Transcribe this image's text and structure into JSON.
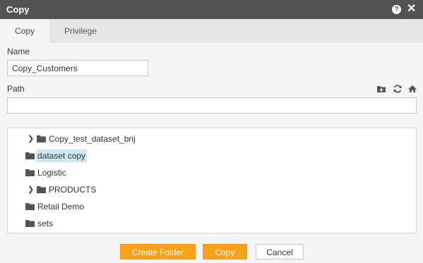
{
  "dialog": {
    "title": "Copy",
    "help_icon": "question-circle-icon",
    "help_glyph": "?",
    "close_icon": "close-icon",
    "close_glyph": "✕"
  },
  "tabs": [
    {
      "label": "Copy",
      "active": true
    },
    {
      "label": "Privilege",
      "active": false
    }
  ],
  "form": {
    "name_label": "Name",
    "name_value": "Copy_Customers",
    "path_label": "Path",
    "path_value": "",
    "path_tools": [
      "new-folder-icon",
      "refresh-icon",
      "home-icon"
    ]
  },
  "tree": {
    "items": [
      {
        "label": "Copy_test_dataset_brij",
        "expandable": true,
        "selected": false
      },
      {
        "label": "dataset copy",
        "expandable": false,
        "selected": true
      },
      {
        "label": "Logistic",
        "expandable": false,
        "selected": false
      },
      {
        "label": "PRODUCTS",
        "expandable": true,
        "selected": false
      },
      {
        "label": "Retail Demo",
        "expandable": false,
        "selected": false
      },
      {
        "label": "sets",
        "expandable": false,
        "selected": false
      }
    ],
    "caret_glyph": "❯",
    "folder_icon": "folder-icon"
  },
  "buttons": {
    "create_folder": "Create Folder",
    "copy": "Copy",
    "cancel": "Cancel"
  },
  "colors": {
    "titlebar": "#535353",
    "accent_button": "#f7a21b",
    "selection": "#cfe8f6"
  }
}
